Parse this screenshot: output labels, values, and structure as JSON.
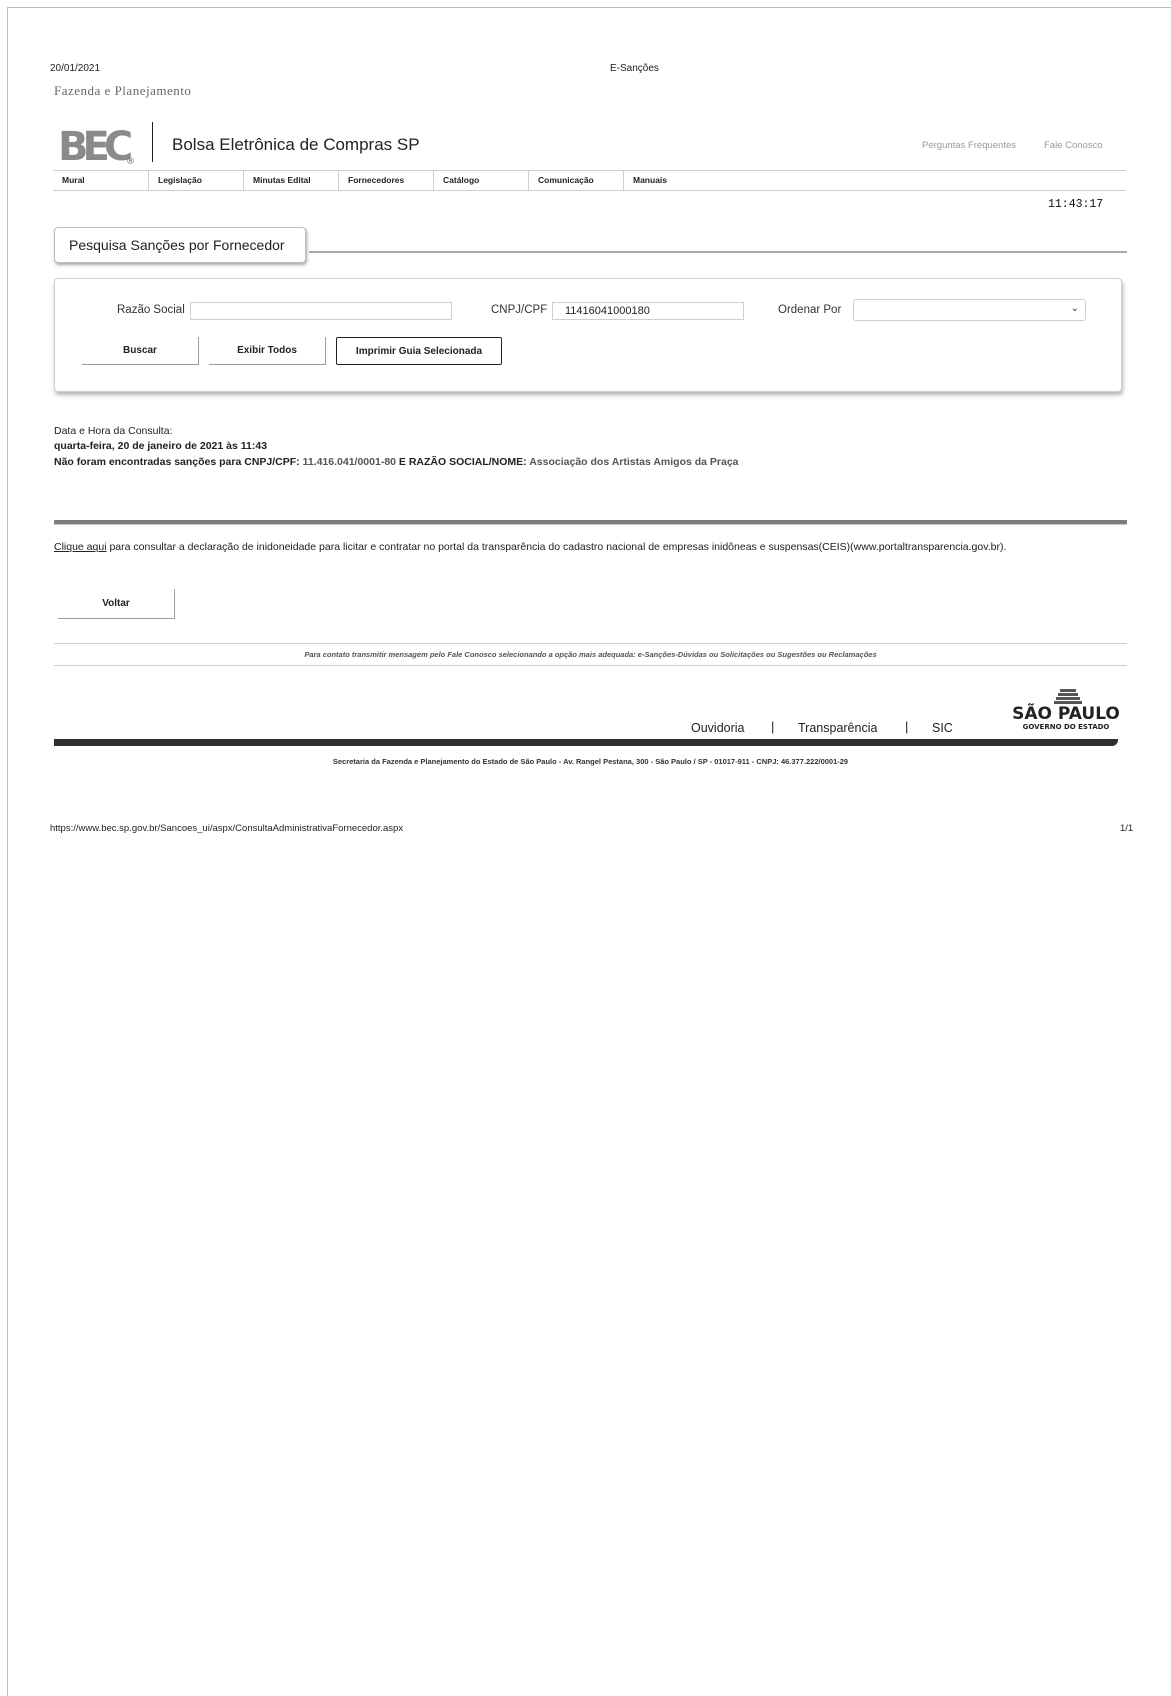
{
  "print_header": {
    "date": "20/01/2021",
    "title": "E-Sanções"
  },
  "brand": {
    "subtitle": "Fazenda e Planejamento",
    "logo_text": "BEC",
    "site_name": "Bolsa Eletrônica de Compras SP"
  },
  "top_links": {
    "faq": "Perguntas Frequentes",
    "contact": "Fale Conosco"
  },
  "nav": {
    "items": [
      "Mural",
      "Legislação",
      "Minutas Edital",
      "Fornecedores",
      "Catálogo",
      "Comunicação",
      "Manuais"
    ]
  },
  "clock": "11:43:17",
  "search": {
    "tab_title": "Pesquisa Sanções por Fornecedor",
    "razao_label": "Razão Social",
    "razao_value": "",
    "cnpj_label": "CNPJ/CPF",
    "cnpj_value": "11416041000180",
    "order_label": "Ordenar Por",
    "order_value": "",
    "buttons": {
      "search": "Buscar",
      "show_all": "Exibir Todos",
      "print": "Imprimir Guia Selecionada"
    }
  },
  "result": {
    "label": "Data e Hora da Consulta:",
    "datetime": "quarta-feira, 20 de janeiro de 2021 às 11:43",
    "msg_prefix": "Não foram encontradas sanções para CNPJ/CPF: ",
    "cnpj": "11.416.041/0001-80",
    "msg_mid": " E RAZÃO SOCIAL/NOME: ",
    "name": "Associação dos Artistas Amigos da Praça"
  },
  "ceis": {
    "link": "Clique aqui",
    "text": " para consultar a declaração de inidoneidade para licitar e contratar no portal da transparência do cadastro nacional de empresas inidôneas e suspensas(CEIS)(www.portaltransparencia.gov.br)."
  },
  "back_button": "Voltar",
  "contact_note": "Para contato transmitir mensagem pelo Fale Conosco selecionando a opção mais adequada: e-Sanções-Dúvidas ou Solicitações ou Sugestões ou Reclamações",
  "footer": {
    "links": [
      "Ouvidoria",
      "Transparência",
      "SIC"
    ],
    "separator": "|",
    "sp_logo_title": "SÃO PAULO",
    "sp_logo_sub": "GOVERNO DO ESTADO",
    "address": "Secretaria da Fazenda e Planejamento do Estado de São Paulo - Av. Rangel Pestana, 300 - São Paulo / SP - 01017-911 - CNPJ: 46.377.222/0001-29"
  },
  "print_footer": {
    "url": "https://www.bec.sp.gov.br/Sancoes_ui/aspx/ConsultaAdministrativaFornecedor.aspx",
    "page": "1/1"
  }
}
